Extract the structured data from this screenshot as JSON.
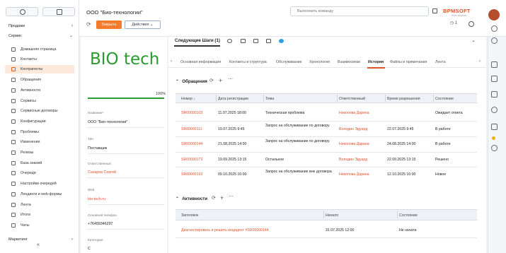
{
  "app": {
    "record_title": "ООО \"Био-технологии\"",
    "command_placeholder": "Выполнить команду",
    "logo": "BPMSOFT",
    "logo_sub": "платформа",
    "notifications_count": "1"
  },
  "sidebar": {
    "sections": [
      {
        "label": "Продажи"
      },
      {
        "label": "Сервис"
      },
      {
        "label": "Маркетинг"
      }
    ],
    "items": [
      {
        "label": "Домашняя страница"
      },
      {
        "label": "Контакты"
      },
      {
        "label": "Контрагенты"
      },
      {
        "label": "Обращения"
      },
      {
        "label": "Активности"
      },
      {
        "label": "Сервисы"
      },
      {
        "label": "Сервисные договоры"
      },
      {
        "label": "Конфигурации"
      },
      {
        "label": "Проблемы"
      },
      {
        "label": "Изменения"
      },
      {
        "label": "Релизы"
      },
      {
        "label": "База знаний"
      },
      {
        "label": "Очереди"
      },
      {
        "label": "Настройки очередей"
      },
      {
        "label": "Лендинги и web-формы"
      },
      {
        "label": "Лента"
      },
      {
        "label": "Итоги"
      },
      {
        "label": "Чаты"
      }
    ],
    "collapse_glyph": "«"
  },
  "toolbar": {
    "close_label": "Закрыть",
    "actions_label": "Действия"
  },
  "profile": {
    "logo_text": "BIO tech",
    "completeness": "100%",
    "fields": [
      {
        "label": "Название*",
        "value": "ООО \"Био-технологии\"",
        "link": false
      },
      {
        "label": "Тип",
        "value": "Поставщик",
        "link": false
      },
      {
        "label": "Ответственный",
        "value": "Сахаров Сергей",
        "link": true
      },
      {
        "label": "Web",
        "value": "bio-tech.ru",
        "link": true
      },
      {
        "label": "Основной телефон",
        "value": "+76499346297",
        "link": false
      },
      {
        "label": "Категория",
        "value": "C",
        "link": false
      }
    ]
  },
  "next_steps": {
    "label": "Следующие Шаги (1)"
  },
  "tabs": [
    {
      "label": "Основная информация"
    },
    {
      "label": "Контакты и структура"
    },
    {
      "label": "Обслуживание"
    },
    {
      "label": "Хронология"
    },
    {
      "label": "Взаимосвязи"
    },
    {
      "label": "История"
    },
    {
      "label": "Файлы и примечания"
    },
    {
      "label": "Лента"
    }
  ],
  "cases": {
    "title": "Обращения",
    "columns": [
      "Номер",
      "Дата регистрации",
      "Тема",
      "Ответственный",
      "Время разрешения",
      "Состояние"
    ],
    "rows": [
      {
        "number": "SR00000103",
        "date": "11.07.2025 18:00",
        "subject": "Техническая проблема",
        "owner": "Николова Дарина",
        "resolution": "",
        "status": "Ожидает ответа"
      },
      {
        "number": "SR00000111",
        "date": "19.07.2025 9:45",
        "subject": "Запрос на обслуживание по договору",
        "owner": "Володин Эдуард",
        "resolution": "22.07.2025 9:45",
        "status": "В работе"
      },
      {
        "number": "SR00000144",
        "date": "21.08.2025 14:00",
        "subject": "Запрос на обслуживание по договору",
        "owner": "Николова Дарина",
        "resolution": "24.08.2025 14:00",
        "status": "В работе"
      },
      {
        "number": "SR00000173",
        "date": "19.09.2025 13:15",
        "subject": "Остальное",
        "owner": "Володин Эдуард",
        "resolution": "22.09.2025 13:15",
        "status": "Решено"
      },
      {
        "number": "SR00000193",
        "date": "09.10.2025 16:00",
        "subject": "Запрос на обслуживание вне договора",
        "owner": "Николова Дарина",
        "resolution": "12.10.2025 16:00",
        "status": "Новое"
      }
    ]
  },
  "activities": {
    "title": "Активности",
    "columns": [
      "Заголовок",
      "Начало",
      "Состояние"
    ],
    "rows": [
      {
        "title": "Диагностировать и решить инцидент #SR00000144",
        "start": "31.07.2025 12:00",
        "status": "Не начата"
      }
    ]
  }
}
